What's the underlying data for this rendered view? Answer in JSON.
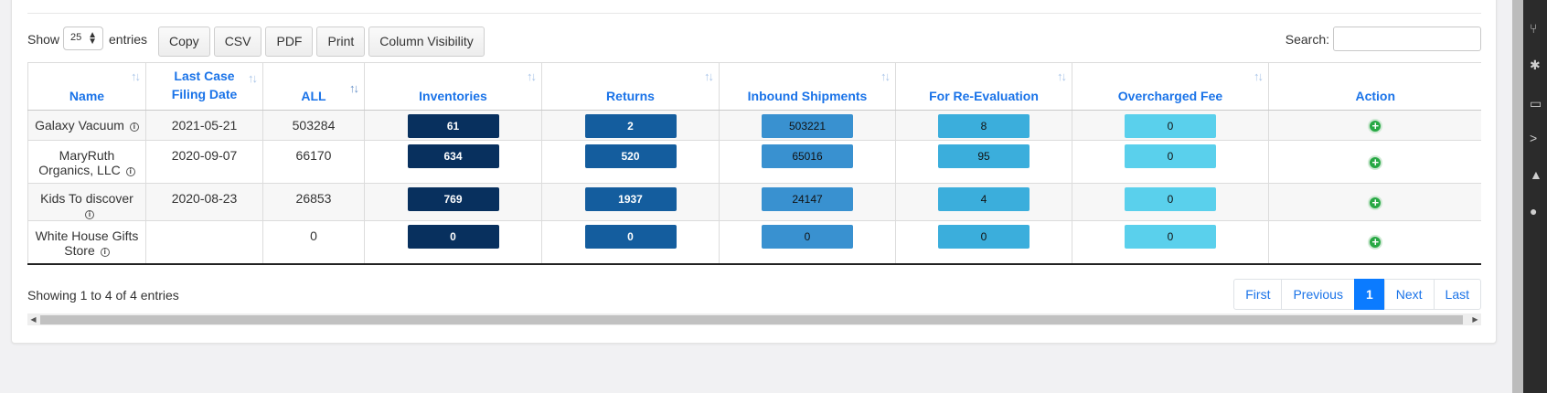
{
  "controls": {
    "show_label": "Show",
    "page_length": "25",
    "entries_label": "entries",
    "buttons": [
      "Copy",
      "CSV",
      "PDF",
      "Print",
      "Column Visibility"
    ],
    "search_label": "Search:",
    "search_value": ""
  },
  "table": {
    "headers": [
      "Name",
      "Last Case Filing Date",
      "ALL",
      "Inventories",
      "Returns",
      "Inbound Shipments",
      "For Re-Evaluation",
      "Overcharged Fee",
      "Action"
    ],
    "rows": [
      {
        "name": "Galaxy Vacuum",
        "date": "2021-05-21",
        "all": "503284",
        "inventories": "61",
        "returns": "2",
        "inbound": "503221",
        "reeval": "8",
        "overcharged": "0"
      },
      {
        "name": "MaryRuth Organics, LLC",
        "date": "2020-09-07",
        "all": "66170",
        "inventories": "634",
        "returns": "520",
        "inbound": "65016",
        "reeval": "95",
        "overcharged": "0"
      },
      {
        "name": "Kids To discover",
        "date": "2020-08-23",
        "all": "26853",
        "inventories": "769",
        "returns": "1937",
        "inbound": "24147",
        "reeval": "4",
        "overcharged": "0"
      },
      {
        "name": "White House Gifts Store",
        "date": "",
        "all": "0",
        "inventories": "0",
        "returns": "0",
        "inbound": "0",
        "reeval": "0",
        "overcharged": "0"
      }
    ]
  },
  "footer": {
    "info": "Showing 1 to 4 of 4 entries",
    "pager": [
      "First",
      "Previous",
      "1",
      "Next",
      "Last"
    ]
  },
  "icons": {
    "info": "info-icon",
    "add": "add-circle-icon",
    "sort": "sort-icon"
  },
  "colors": {
    "inventories": "#08305e",
    "returns": "#145d9e",
    "inbound": "#3991d0",
    "reeval": "#3baedc",
    "overcharged": "#5ad0ec",
    "add": "#27a844",
    "link": "#1a73e8"
  }
}
